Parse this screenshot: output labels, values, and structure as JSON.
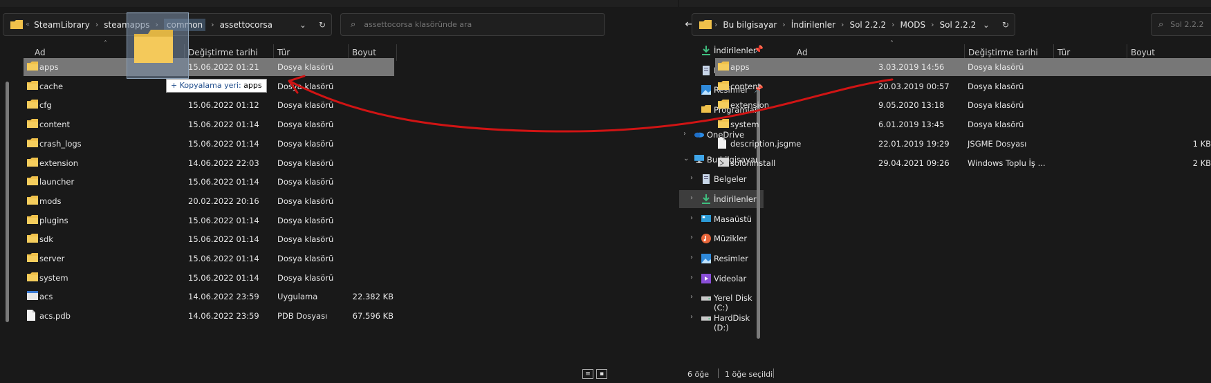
{
  "left": {
    "breadcrumb": [
      "SteamLibrary",
      "steamapps",
      "common",
      "assettocorsa"
    ],
    "search_placeholder": "assettocorsa klasöründe ara",
    "columns": {
      "name": "Ad",
      "date": "Değiştirme tarihi",
      "type": "Tür",
      "size": "Boyut"
    },
    "rows": [
      {
        "name": "apps",
        "date": "15.06.2022 01:21",
        "type": "Dosya klasörü",
        "size": "",
        "icon": "folder-icon",
        "selected": true
      },
      {
        "name": "cache",
        "date": "",
        "type": "Dosya klasörü",
        "size": "",
        "icon": "folder-icon"
      },
      {
        "name": "cfg",
        "date": "15.06.2022 01:12",
        "type": "Dosya klasörü",
        "size": "",
        "icon": "folder-icon"
      },
      {
        "name": "content",
        "date": "15.06.2022 01:14",
        "type": "Dosya klasörü",
        "size": "",
        "icon": "folder-icon"
      },
      {
        "name": "crash_logs",
        "date": "15.06.2022 01:14",
        "type": "Dosya klasörü",
        "size": "",
        "icon": "folder-icon"
      },
      {
        "name": "extension",
        "date": "14.06.2022 22:03",
        "type": "Dosya klasörü",
        "size": "",
        "icon": "folder-icon"
      },
      {
        "name": "launcher",
        "date": "15.06.2022 01:14",
        "type": "Dosya klasörü",
        "size": "",
        "icon": "folder-icon"
      },
      {
        "name": "mods",
        "date": "20.02.2022 20:16",
        "type": "Dosya klasörü",
        "size": "",
        "icon": "folder-icon"
      },
      {
        "name": "plugins",
        "date": "15.06.2022 01:14",
        "type": "Dosya klasörü",
        "size": "",
        "icon": "folder-icon"
      },
      {
        "name": "sdk",
        "date": "15.06.2022 01:14",
        "type": "Dosya klasörü",
        "size": "",
        "icon": "folder-icon"
      },
      {
        "name": "server",
        "date": "15.06.2022 01:14",
        "type": "Dosya klasörü",
        "size": "",
        "icon": "folder-icon"
      },
      {
        "name": "system",
        "date": "15.06.2022 01:14",
        "type": "Dosya klasörü",
        "size": "",
        "icon": "folder-icon"
      },
      {
        "name": "acs",
        "date": "14.06.2022 23:59",
        "type": "Uygulama",
        "size": "22.382 KB",
        "icon": "app-icon"
      },
      {
        "name": "acs.pdb",
        "date": "14.06.2022 23:59",
        "type": "PDB Dosyası",
        "size": "67.596 KB",
        "icon": "file-icon"
      }
    ],
    "copy_tooltip": {
      "prefix": "+ Kopyalama yeri:",
      "target": "apps"
    }
  },
  "right": {
    "breadcrumb": [
      "Bu bilgisayar",
      "İndirilenler",
      "Sol 2.2.2",
      "MODS",
      "Sol 2.2.2"
    ],
    "search_placeholder": "Sol 2.2.2",
    "quick_access": [
      {
        "label": "İndirilenler",
        "icon": "download-icon"
      },
      {
        "label": "Belgeler",
        "icon": "documents-icon"
      },
      {
        "label": "Resimler",
        "icon": "pictures-icon"
      },
      {
        "label": "Programlar",
        "icon": "folder-icon"
      }
    ],
    "tree": [
      {
        "label": "OneDrive",
        "icon": "onedrive-icon",
        "chevron": "›"
      },
      {
        "label": "Bu bilgisayar",
        "icon": "computer-icon",
        "chevron": "⌄"
      },
      {
        "label": "Belgeler",
        "icon": "documents-icon",
        "chevron": "›"
      },
      {
        "label": "İndirilenler",
        "icon": "download-icon",
        "chevron": "›",
        "selected": true
      },
      {
        "label": "Masaüstü",
        "icon": "desktop-icon",
        "chevron": "›"
      },
      {
        "label": "Müzikler",
        "icon": "music-icon",
        "chevron": "›"
      },
      {
        "label": "Resimler",
        "icon": "pictures-icon",
        "chevron": "›"
      },
      {
        "label": "Videolar",
        "icon": "videos-icon",
        "chevron": "›"
      },
      {
        "label": "Yerel Disk (C:)",
        "icon": "drive-icon",
        "chevron": "›"
      },
      {
        "label": "HardDisk (D:)",
        "icon": "drive-icon",
        "chevron": "›"
      }
    ],
    "columns": {
      "name": "Ad",
      "date": "Değiştirme tarihi",
      "type": "Tür",
      "size": "Boyut"
    },
    "rows": [
      {
        "name": "apps",
        "date": "3.03.2019 14:56",
        "type": "Dosya klasörü",
        "size": "",
        "icon": "folder-icon",
        "selected": true
      },
      {
        "name": "content",
        "date": "20.03.2019 00:57",
        "type": "Dosya klasörü",
        "size": "",
        "icon": "folder-icon"
      },
      {
        "name": "extension",
        "date": "9.05.2020 13:18",
        "type": "Dosya klasörü",
        "size": "",
        "icon": "folder-icon"
      },
      {
        "name": "system",
        "date": "6.01.2019 13:45",
        "type": "Dosya klasörü",
        "size": "",
        "icon": "folder-icon"
      },
      {
        "name": "description.jsgme",
        "date": "22.01.2019 19:29",
        "type": "JSGME Dosyası",
        "size": "1 KB",
        "icon": "file-icon"
      },
      {
        "name": "soluninstall",
        "date": "29.04.2021 09:26",
        "type": "Windows Toplu İş ...",
        "size": "2 KB",
        "icon": "batch-icon"
      }
    ],
    "status": {
      "count": "6 öğe",
      "selected": "1 öğe seçildi"
    }
  },
  "colors": {
    "background": "#191919",
    "selection": "#777777",
    "folder": "#f0c14b",
    "arrow": "#d01414"
  }
}
